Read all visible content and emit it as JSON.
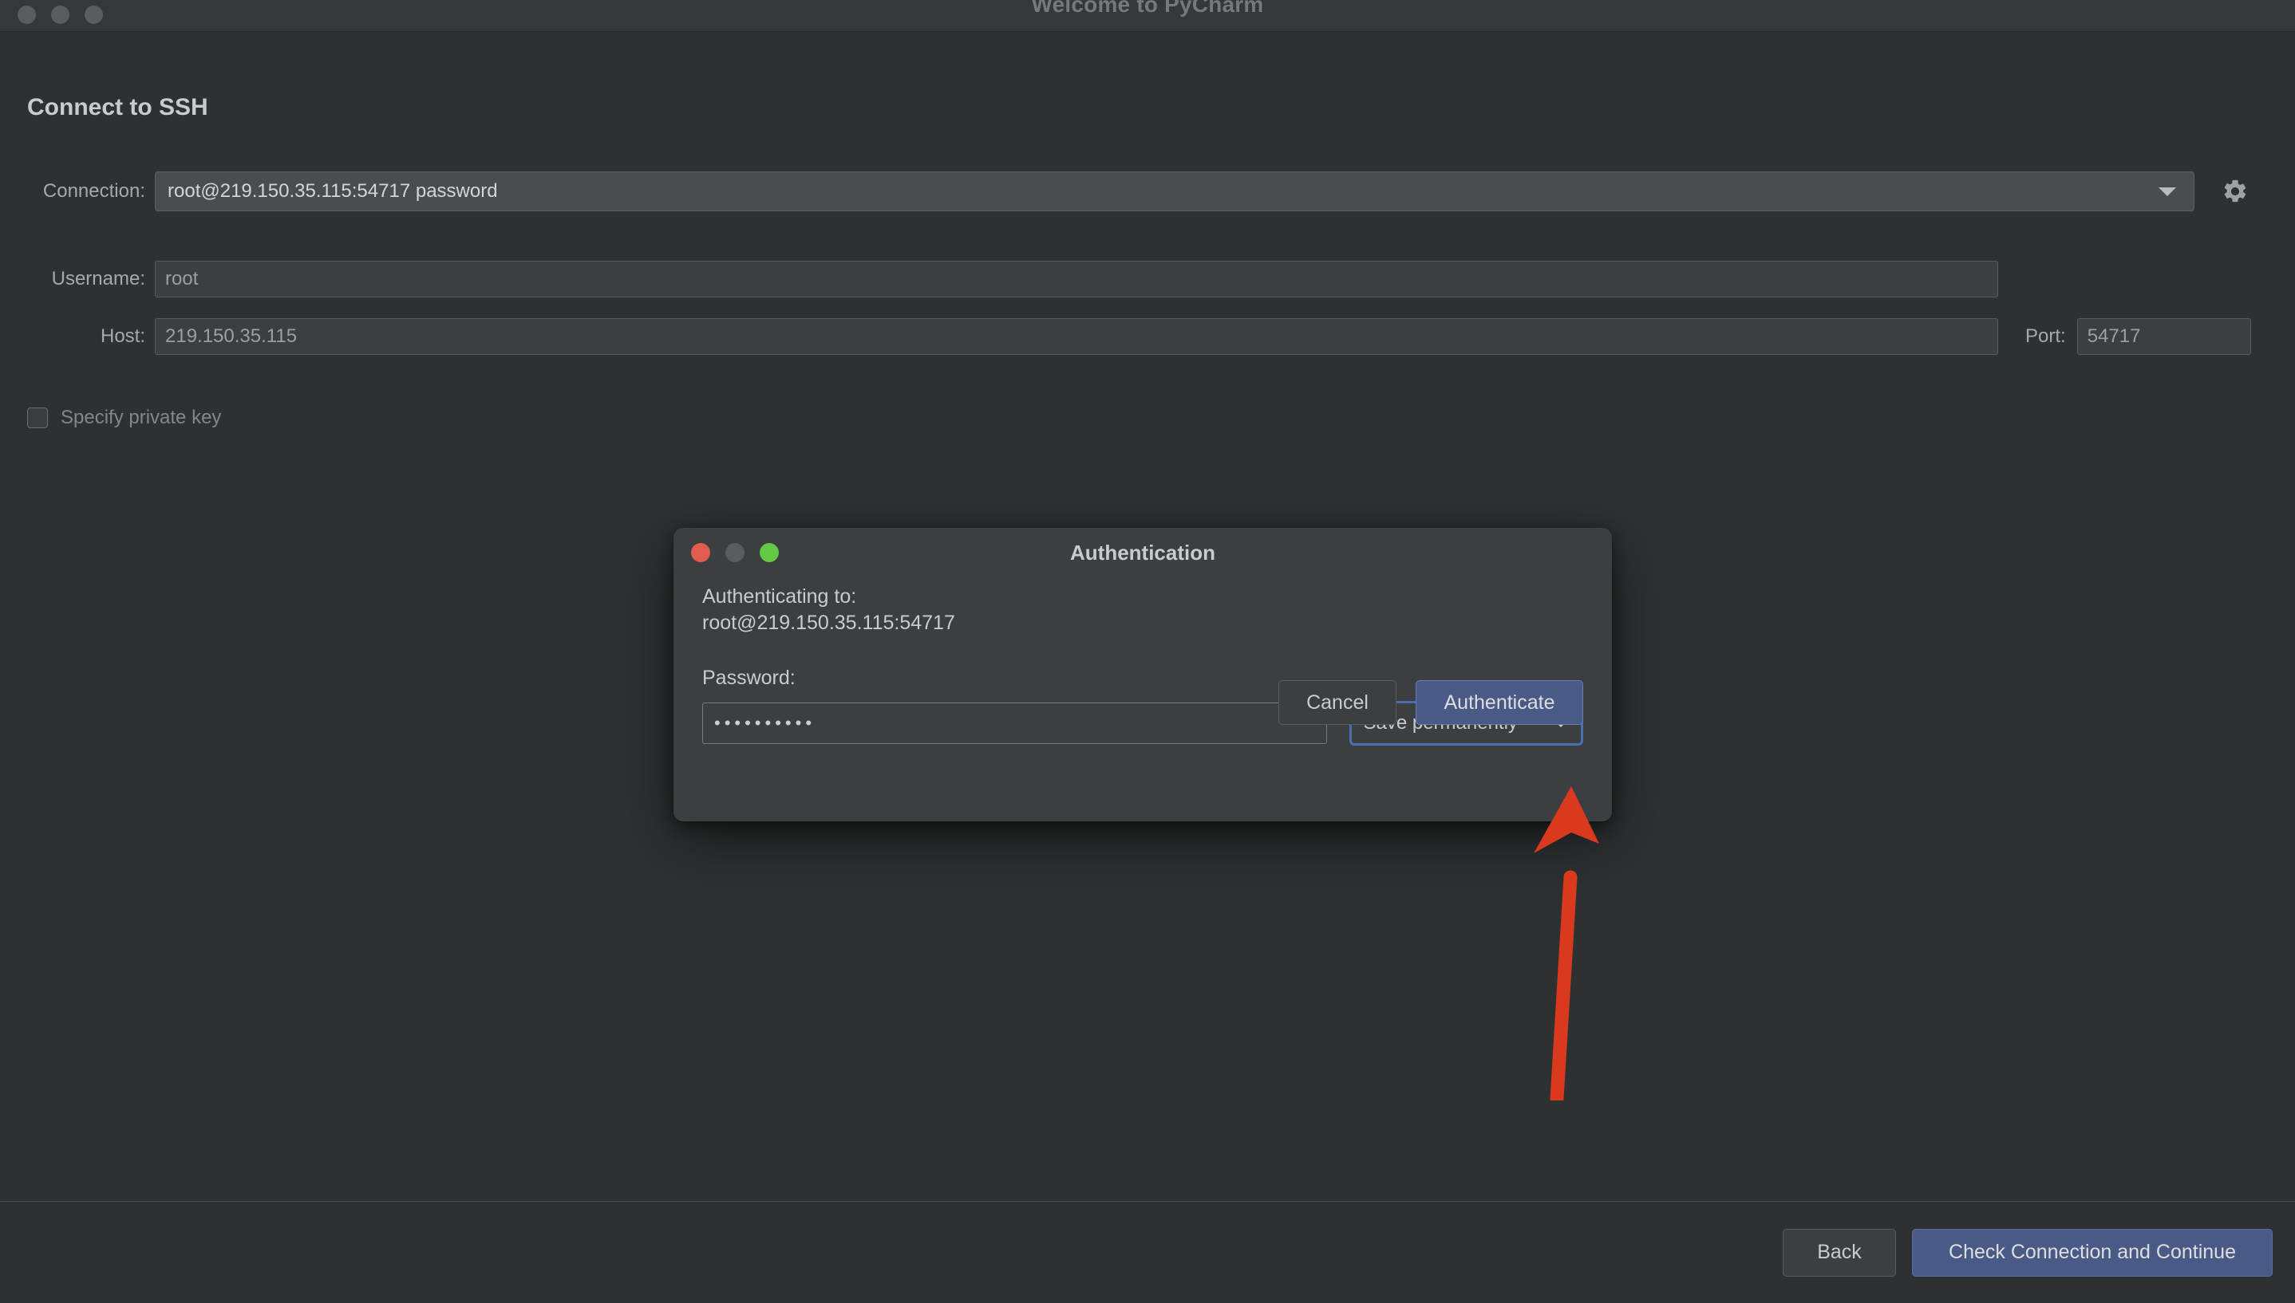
{
  "window": {
    "title": "Welcome to PyCharm",
    "traffic_lights": [
      "close",
      "minimize",
      "zoom"
    ]
  },
  "page": {
    "title": "Connect to SSH"
  },
  "form": {
    "connection": {
      "label": "Connection:",
      "value": "root@219.150.35.115:54717 password",
      "settings_icon": "gear-icon",
      "dropdown_icon": "chevron-down-icon"
    },
    "username": {
      "label": "Username:",
      "value": "root",
      "placeholder": "root"
    },
    "host": {
      "label": "Host:",
      "value": "219.150.35.115",
      "placeholder": "219.150.35.115"
    },
    "port": {
      "label": "Port:",
      "value": "54717",
      "placeholder": "54717"
    },
    "private_key": {
      "label": "Specify private key",
      "checked": false
    }
  },
  "footer": {
    "back_label": "Back",
    "continue_label": "Check Connection and Continue"
  },
  "auth_dialog": {
    "title": "Authentication",
    "traffic_lights": [
      "close",
      "minimize",
      "zoom"
    ],
    "authenticating_label": "Authenticating to:",
    "target": "root@219.150.35.115:54717",
    "password_label": "Password:",
    "password_value": "••••••••••",
    "save_mode": {
      "selected": "Save permanently",
      "dropdown_icon": "chevron-down-icon"
    },
    "cancel_label": "Cancel",
    "authenticate_label": "Authenticate"
  },
  "annotation": {
    "type": "arrow",
    "points_to": "authenticate-button",
    "color": "#d93a1e"
  },
  "colors": {
    "window_background": "#2e3132",
    "titlebar_background": "#353839",
    "dialog_background": "#3c3f41",
    "primary_button": "#4a5a86",
    "focus_ring": "#4b6eaf",
    "annotation_red": "#d93a1e",
    "text_primary": "#c9cbcc",
    "text_secondary": "#9c9fa1"
  }
}
